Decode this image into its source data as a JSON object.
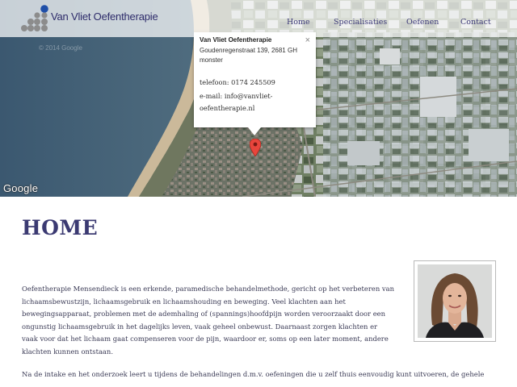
{
  "header": {
    "logo_text": "Van Vliet Oefentherapie",
    "nav": [
      {
        "label": "Home"
      },
      {
        "label": "Specialisaties"
      },
      {
        "label": "Oefenen"
      },
      {
        "label": "Contact"
      }
    ]
  },
  "map": {
    "google_logo": "Google",
    "ghost_copyright": "© 2014 Google",
    "info_window": {
      "name": "Van Vliet Oefentherapie",
      "address": "Goudenregenstraat 139, 2681 GH monster",
      "phone": "telefoon: 0174 245509",
      "email": "e-mail: info@vanvliet-oefentherapie.nl",
      "close_glyph": "×"
    }
  },
  "main": {
    "title": "HOME",
    "paragraphs": [
      "Oefentherapie Mensendieck is een erkende, paramedische behandelmethode, gericht op het verbeteren van lichaamsbewustzijn, lichaamsgebruik en lichaamshouding en beweging. Veel klachten aan het bewegingsapparaat, problemen met de ademhaling of (spannings)hoofdpijn worden veroorzaakt door een ongunstig lichaamsgebruik in het dagelijks leven, vaak geheel onbewust. Daarnaast zorgen klachten er vaak voor dat het lichaam gaat compenseren voor de pijn, waardoor er, soms op een later moment, andere klachten kunnen ontstaan.",
      "Na de intake en het onderzoek leert u tijdens de behandelingen d.m.v. oefeningen die u zelf thuis eenvoudig kunt uitvoeren, de gehele"
    ]
  },
  "colors": {
    "brand": "#2d2b6a",
    "nav": "#3d3a78",
    "logo_dot_blue": "#1f4fa8",
    "logo_dot_gray": "#8c8c8c",
    "marker": "#e8453c"
  }
}
